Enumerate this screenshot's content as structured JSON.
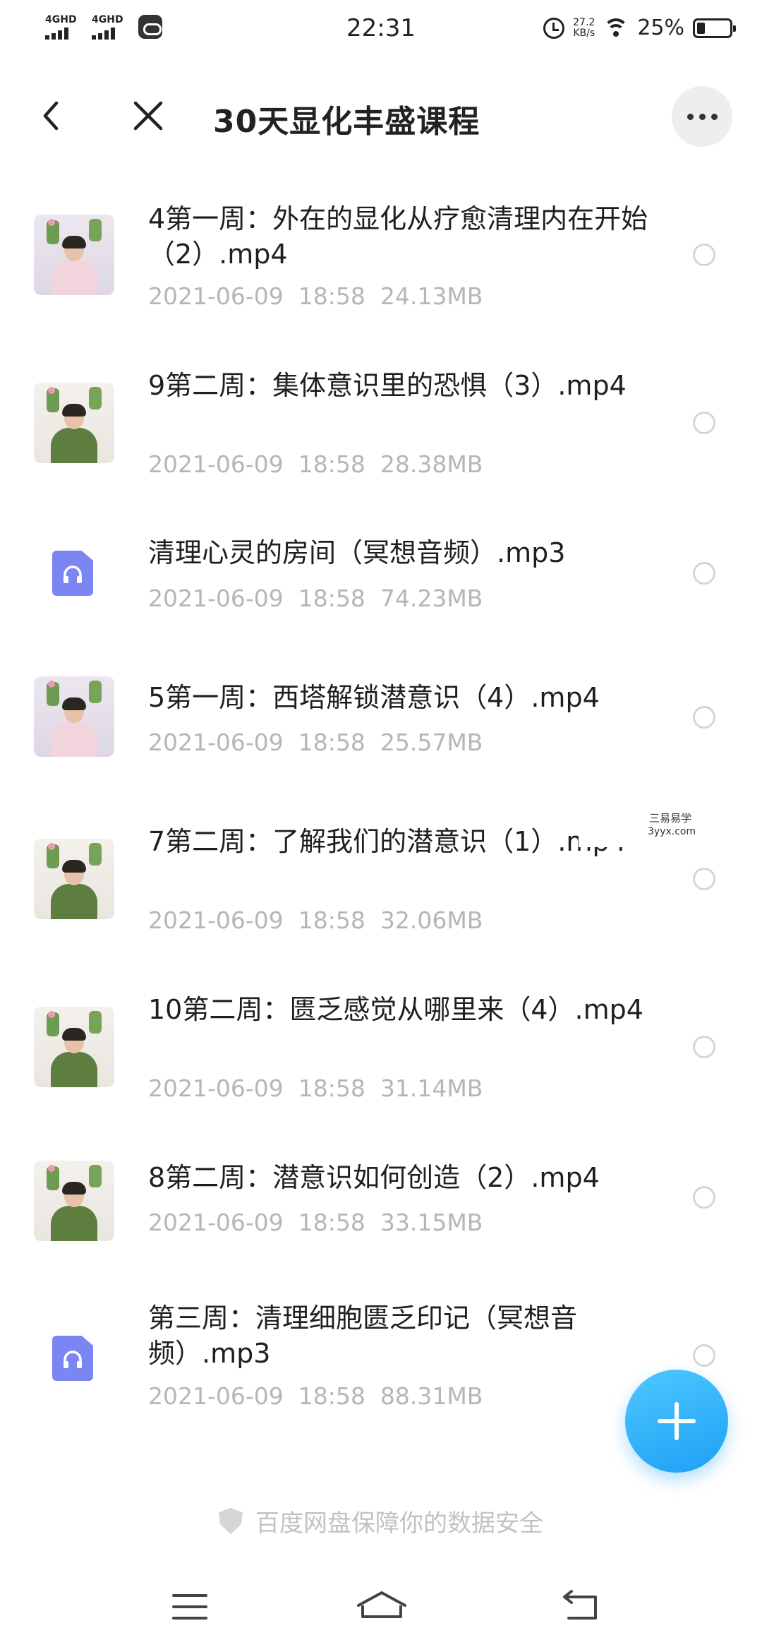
{
  "status_bar": {
    "signal_1": "4GHD",
    "signal_2": "4GHD",
    "app_icon": "baidu-netdisk-icon",
    "time": "22:31",
    "speed_value": "27.2",
    "speed_unit": "KB/s",
    "battery_percent": "25%",
    "battery_level": 0.25
  },
  "header": {
    "title": "30天显化丰盛课程",
    "back_icon": "chevron-left-icon",
    "close_icon": "close-icon",
    "more_icon": "more-icon"
  },
  "files": [
    {
      "name": "4第一周：外在的显化从疗愈清理内在开始（2）.mp4",
      "date": "2021-06-09  18:58",
      "size": "24.13MB",
      "type": "video"
    },
    {
      "name": "9第二周：集体意识里的恐惧（3）.mp4",
      "date": "2021-06-09  18:58",
      "size": "28.38MB",
      "type": "video"
    },
    {
      "name": "清理心灵的房间（冥想音频）.mp3",
      "date": "2021-06-09  18:58",
      "size": "74.23MB",
      "type": "audio"
    },
    {
      "name": "5第一周：西塔解锁潜意识（4）.mp4",
      "date": "2021-06-09  18:58",
      "size": "25.57MB",
      "type": "video"
    },
    {
      "name": "7第二周：了解我们的潜意识（1）.mp4",
      "date": "2021-06-09  18:58",
      "size": "32.06MB",
      "type": "video"
    },
    {
      "name": "10第二周：匮乏感觉从哪里来（4）.mp4",
      "date": "2021-06-09  18:58",
      "size": "31.14MB",
      "type": "video"
    },
    {
      "name": "8第二周：潜意识如何创造（2）.mp4",
      "date": "2021-06-09  18:58",
      "size": "33.15MB",
      "type": "video"
    },
    {
      "name": "第三周：清理细胞匮乏印记（冥想音频）.mp3",
      "date": "2021-06-09  18:58",
      "size": "88.31MB",
      "type": "audio"
    }
  ],
  "watermark": {
    "line1": "三易易学",
    "line2": "3yyx.com"
  },
  "footer": {
    "note": "百度网盘保障你的数据安全"
  },
  "colors": {
    "accent": "#1ea0f5",
    "audio_icon": "#7b86f2",
    "meta_text": "#b6b6b6"
  }
}
